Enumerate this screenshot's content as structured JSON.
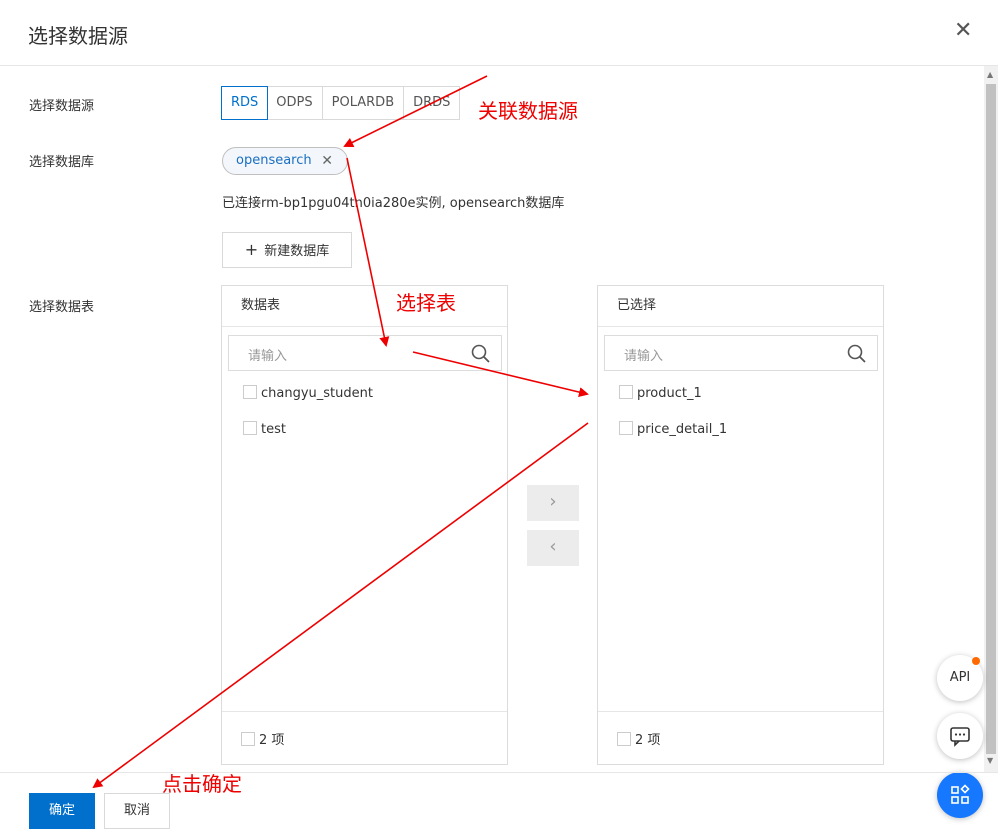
{
  "dialog": {
    "title": "选择数据源"
  },
  "form": {
    "datasource_label": "选择数据源",
    "database_label": "选择数据库",
    "table_label": "选择数据表"
  },
  "datasource_tabs": [
    "RDS",
    "ODPS",
    "POLARDB",
    "DRDS"
  ],
  "selected_datasource": "RDS",
  "database_tag": "opensearch",
  "connection_info": "已连接rm-bp1pgu04tn0ia280e实例, opensearch数据库",
  "new_db_button": "新建数据库",
  "left_panel": {
    "title": "数据表",
    "search_placeholder": "请输入",
    "items": [
      "changyu_student",
      "test"
    ],
    "count": "2 项"
  },
  "right_panel": {
    "title": "已选择",
    "search_placeholder": "请输入",
    "items": [
      "product_1",
      "price_detail_1"
    ],
    "count": "2 项"
  },
  "transfer": {
    "right": "›",
    "left": "‹"
  },
  "footer": {
    "ok": "确定",
    "cancel": "取消"
  },
  "floating": {
    "api": "API",
    "chat_icon": "message-icon",
    "apps_icon": "apps-icon"
  },
  "annotations": {
    "relate": "关联数据源",
    "select_table": "选择表",
    "click_ok": "点击确定"
  },
  "colors": {
    "primary": "#0070cc",
    "annotation": "#e00000"
  }
}
